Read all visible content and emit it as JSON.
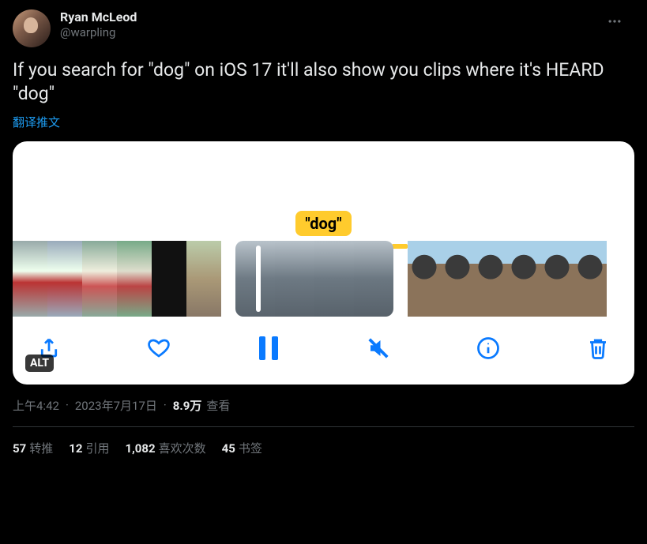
{
  "author": {
    "display_name": "Ryan McLeod",
    "handle": "@warpling"
  },
  "tweet_text": "If you search for \"dog\" on iOS 17 it'll also show you clips where it's HEARD \"dog\"",
  "translate_label": "翻译推文",
  "media": {
    "search_tag": "\"dog\"",
    "alt_badge": "ALT",
    "toolbar": {
      "share": "share",
      "like": "like",
      "pause": "pause",
      "mute": "mute",
      "info": "info",
      "delete": "delete"
    }
  },
  "meta": {
    "time": "上午4:42",
    "date": "2023年7月17日",
    "views_number": "8.9万",
    "views_label": "查看"
  },
  "stats": {
    "retweets_num": "57",
    "retweets_label": "转推",
    "quotes_num": "12",
    "quotes_label": "引用",
    "likes_num": "1,082",
    "likes_label": "喜欢次数",
    "bookmarks_num": "45",
    "bookmarks_label": "书签"
  }
}
